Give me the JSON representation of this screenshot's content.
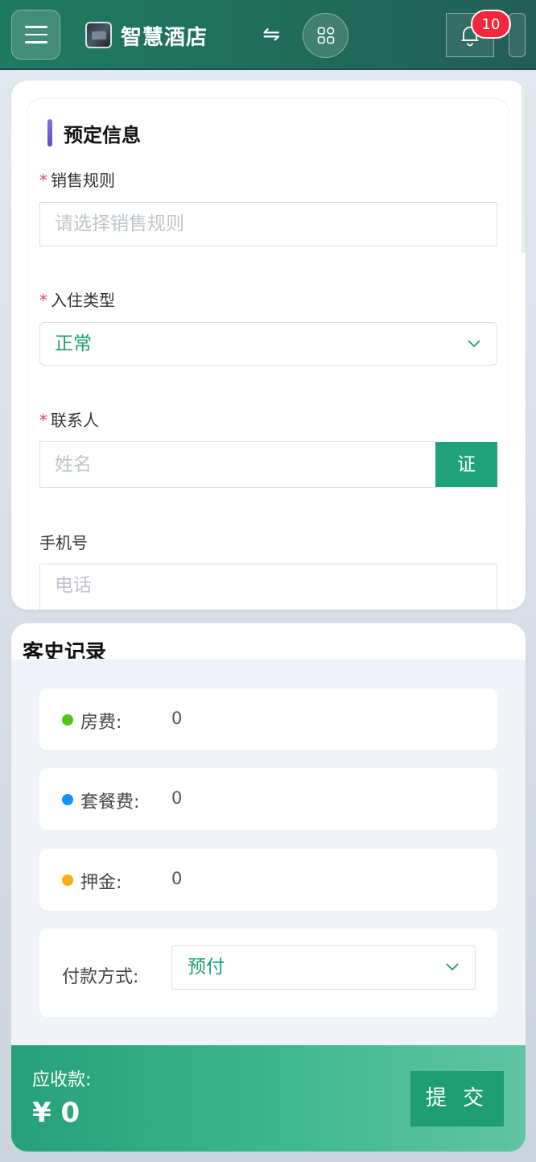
{
  "header": {
    "app_title": "智慧酒店",
    "notification_count": "10",
    "accent_color": "#1e7a60"
  },
  "booking": {
    "section_title": "预定信息",
    "sales_rule": {
      "label": "销售规则",
      "required_mark": "*",
      "placeholder": "请选择销售规则"
    },
    "checkin_type": {
      "label": "入住类型",
      "required_mark": "*",
      "value": "正常"
    },
    "contact": {
      "label": "联系人",
      "required_mark": "*",
      "placeholder": "姓名",
      "id_button": "证"
    },
    "phone": {
      "label": "手机号",
      "placeholder": "电话"
    }
  },
  "guest_history": {
    "title": "客史记录"
  },
  "fees": [
    {
      "label": "房费:",
      "value": "0",
      "dot_color": "#52c41a"
    },
    {
      "label": "套餐费:",
      "value": "0",
      "dot_color": "#1890ff"
    },
    {
      "label": "押金:",
      "value": "0",
      "dot_color": "#faad14"
    }
  ],
  "payment": {
    "label": "付款方式:",
    "value": "预付"
  },
  "footer": {
    "due_label": "应收款:",
    "due_amount": "¥ 0",
    "submit_label": "提 交"
  }
}
